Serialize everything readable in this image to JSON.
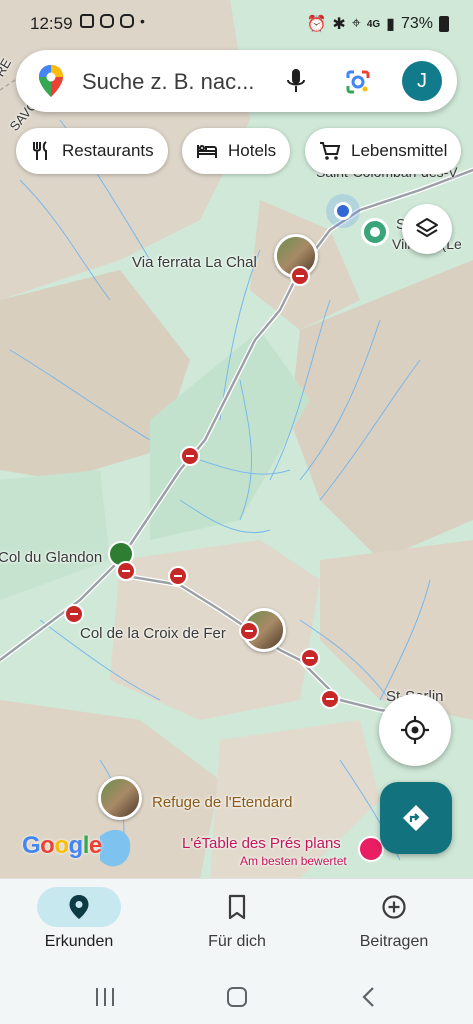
{
  "status_bar": {
    "time": "12:59",
    "left_icons": [
      "gallery-icon",
      "instagram-icon",
      "instagram-icon",
      "dot-icon"
    ],
    "right_text": "73%",
    "network": "4G"
  },
  "search": {
    "placeholder": "Suche z. B. nac...",
    "avatar_initial": "J"
  },
  "chips": [
    {
      "label": "Restaurants",
      "icon": "fork-knife-icon"
    },
    {
      "label": "Hotels",
      "icon": "bed-icon"
    },
    {
      "label": "Lebensmittel",
      "icon": "cart-icon"
    }
  ],
  "map": {
    "labels": {
      "saint_colomban": "Saint-Colomban-des-V",
      "villards": "Villards (Le",
      "s_prefix": "S",
      "via_ferrata": "Via ferrata La Chal",
      "col_du_glandon": "Col du Glandon",
      "col_croix_de_fer": "Col de la Croix de Fer",
      "st_sorlin": "St-Sorlin",
      "refuge": "Refuge de l'Etendard",
      "etable": "L'éTable des Prés plans",
      "etable_sub": "Am besten bewertet",
      "savoie": "SAVO",
      "re": "RE"
    },
    "attribution": "Google",
    "colors": {
      "water": "#4da3f5",
      "road": "#9aa0a6",
      "land": "#cfe8d7",
      "mountain": "#d9d0c2",
      "closure": "#c62828"
    }
  },
  "bottom_nav": {
    "items": [
      {
        "label": "Erkunden",
        "icon": "location-pin-icon",
        "active": true
      },
      {
        "label": "Für dich",
        "icon": "bookmark-icon",
        "active": false
      },
      {
        "label": "Beitragen",
        "icon": "add-circle-icon",
        "active": false
      }
    ]
  }
}
